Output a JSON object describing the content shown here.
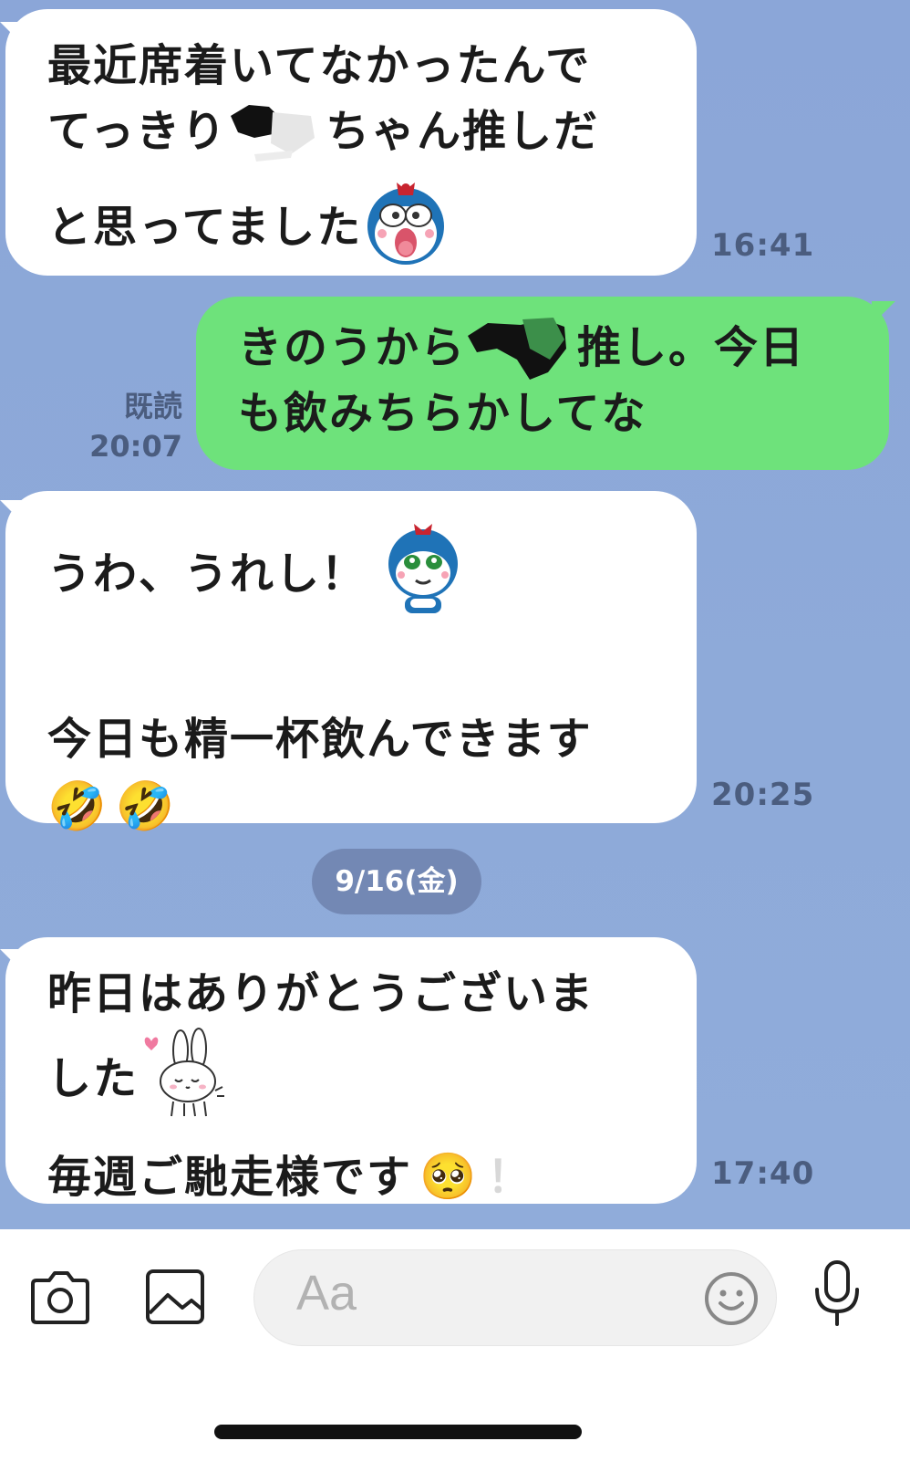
{
  "messages": [
    {
      "direction": "in",
      "lines": [
        "最近席着いてなかったんで",
        "てっきり",
        "ちゃん推しだ",
        "と思ってました"
      ],
      "sticker": "kokin-chan-shocked-sticker",
      "time": "16:41"
    },
    {
      "direction": "out",
      "lines": [
        "きのうから",
        "推し。今日",
        "も飲みちらかしてな"
      ],
      "read_label": "既読",
      "time": "20:07"
    },
    {
      "direction": "in",
      "lines": [
        "うわ、うれし！",
        "今日も精一杯飲んできます"
      ],
      "sticker": "kokin-chan-smiling-sticker",
      "emoji": "🤣🤣",
      "time": "20:25"
    },
    {
      "direction": "in",
      "lines": [
        "昨日はありがとうございま",
        "した",
        "毎週ご馳走様です"
      ],
      "sticker": "bunny-bowing-sticker",
      "emoji": "🥺",
      "exclaim": "！",
      "time": "17:40"
    }
  ],
  "date_divider": "9/16(金)",
  "input_bar": {
    "placeholder": "Aa",
    "icons": [
      "camera-icon",
      "image-icon",
      "emoji-icon",
      "microphone-icon"
    ]
  },
  "colors": {
    "background": "#8ba6d8",
    "incoming_bubble": "#ffffff",
    "outgoing_bubble": "#6ee27b",
    "date_pill": "#7388b4"
  }
}
